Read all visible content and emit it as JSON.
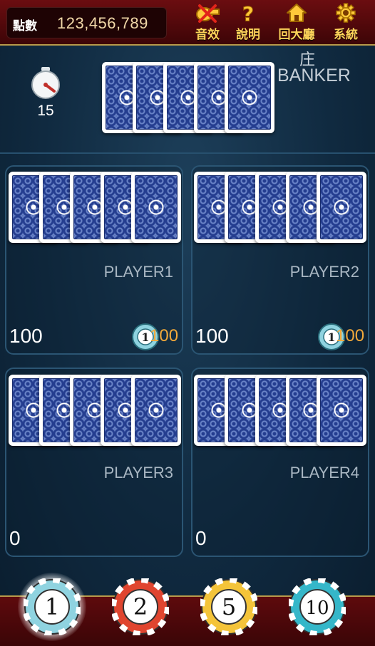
{
  "header": {
    "points_label": "點數",
    "points_value": "123,456,789",
    "menu": [
      {
        "label": "音效",
        "icon": "muted-whistle-icon"
      },
      {
        "label": "說明",
        "icon": "question-mark-icon"
      },
      {
        "label": "回大廳",
        "icon": "home-icon"
      },
      {
        "label": "系統",
        "icon": "gear-icon"
      }
    ]
  },
  "banker": {
    "label_cn": "庄",
    "label_en": "BANKER",
    "timer": "15",
    "cards": 5
  },
  "players": [
    {
      "name": "PLAYER1",
      "bet": "100",
      "chip_bet": "100",
      "chip_value": "1"
    },
    {
      "name": "PLAYER2",
      "bet": "100",
      "chip_bet": "100",
      "chip_value": "1"
    },
    {
      "name": "PLAYER3",
      "bet": "0"
    },
    {
      "name": "PLAYER4",
      "bet": "0"
    }
  ],
  "chips": [
    {
      "value": "1",
      "color": "#8fd3e0",
      "selected": true
    },
    {
      "value": "2",
      "color": "#e0452f",
      "selected": false
    },
    {
      "value": "5",
      "color": "#f4c43a",
      "selected": false
    },
    {
      "value": "10",
      "color": "#35b7c9",
      "selected": false
    }
  ],
  "colors": {
    "header_bg": "#5e0a0d",
    "menu_label": "#ffd45a",
    "points_value": "#f1d8a8",
    "chip_bet_value": "#f2a93b",
    "table_bg": "#102a40"
  }
}
